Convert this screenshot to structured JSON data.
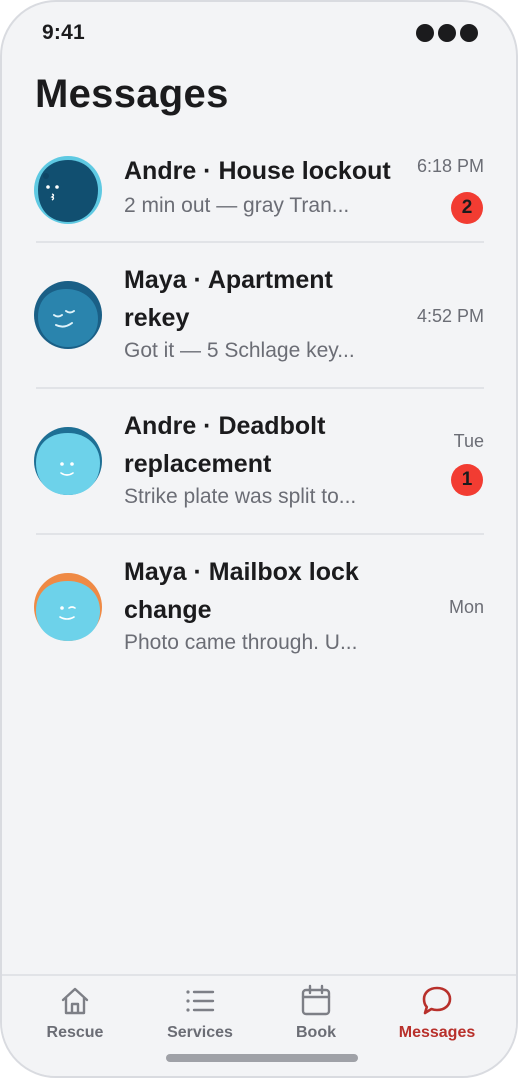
{
  "status_bar": {
    "time": "9:41"
  },
  "header": {
    "title": "Messages"
  },
  "conversations": [
    {
      "name": "Andre · House lockout",
      "preview": "2 min out — gray Tran...",
      "time": "6:18 PM",
      "unread": "2"
    },
    {
      "name": "Maya · Apartment rekey",
      "preview": "Got it — 5 Schlage key...",
      "time": "4:52 PM",
      "unread": null
    },
    {
      "name": "Andre · Deadbolt replacement",
      "preview": "Strike plate was split to...",
      "time": "Tue",
      "unread": "1"
    },
    {
      "name": "Maya · Mailbox lock change",
      "preview": "Photo came through. U...",
      "time": "Mon",
      "unread": null
    }
  ],
  "tab_bar": {
    "tabs": [
      {
        "label": "Rescue",
        "icon": "home-icon"
      },
      {
        "label": "Services",
        "icon": "list-icon"
      },
      {
        "label": "Book",
        "icon": "calendar-icon"
      },
      {
        "label": "Messages",
        "icon": "chat-bubble-icon",
        "active": true
      }
    ]
  },
  "colors": {
    "accent": "#b8302b",
    "badge": "#f23c32",
    "background": "#f3f4f6"
  }
}
